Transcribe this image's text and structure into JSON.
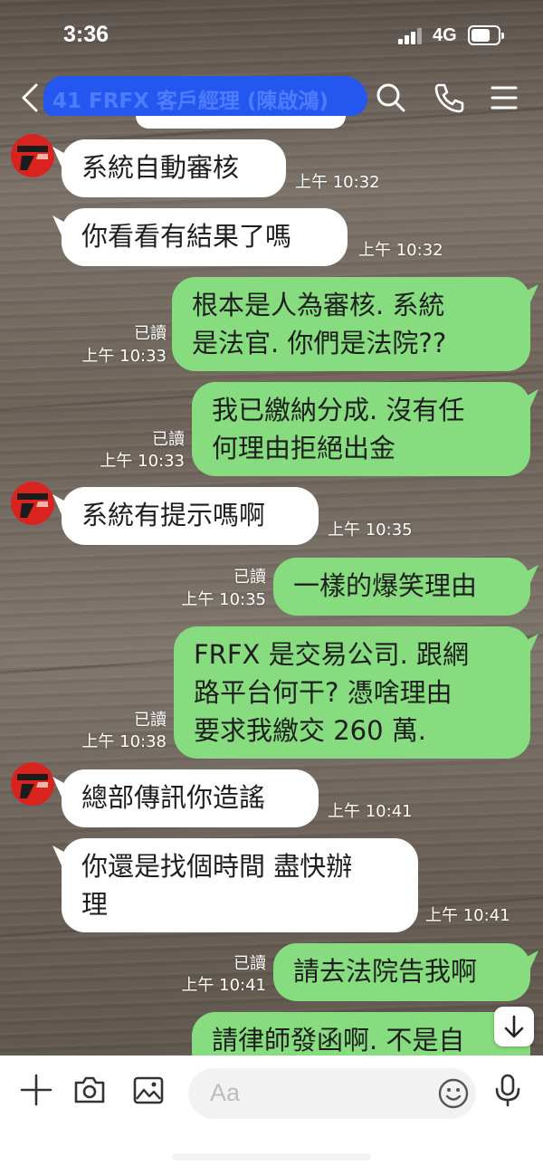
{
  "status_bar": {
    "time": "3:36",
    "network": "4G"
  },
  "header": {
    "title": "41   FRFX 客戶經理 (陳啟鴻)"
  },
  "messages": [
    {
      "text": "系統自動審核",
      "time": "上午 10:32"
    },
    {
      "text": "你看看有結果了嗎",
      "time": "上午 10:32"
    },
    {
      "line1": "根本是人為審核. 系統",
      "line2": "是法官. 你們是法院??",
      "read": "已讀",
      "time": "上午 10:33"
    },
    {
      "line1": "我已繳納分成. 沒有任",
      "line2": "何理由拒絕出金",
      "read": "已讀",
      "time": "上午 10:33"
    },
    {
      "text": "系統有提示嗎啊",
      "time": "上午 10:35"
    },
    {
      "text": "一樣的爆笑理由",
      "read": "已讀",
      "time": "上午 10:35"
    },
    {
      "line1": "FRFX  是交易公司. 跟網",
      "line2": "路平台何干? 憑啥理由",
      "line3": "要求我繳交 260 萬.",
      "read": "已讀",
      "time": "上午 10:38"
    },
    {
      "text": "總部傳訊你造謠",
      "time": "上午 10:41"
    },
    {
      "line1": "你還是找個時間 盡快辦",
      "line2": "理",
      "time": "上午 10:41"
    },
    {
      "text": "請去法院告我啊",
      "read": "已讀",
      "time": "上午 10:41"
    },
    {
      "text": "請律師發函啊. 不是自"
    }
  ],
  "input_bar": {
    "placeholder": "Aa"
  },
  "colors": {
    "incoming_bubble": "#ffffff",
    "outgoing_bubble": "#86dc7e",
    "title_redaction": "#2457f0"
  },
  "icons": [
    "back-icon",
    "search-icon",
    "phone-icon",
    "menu-icon",
    "scroll-down-icon",
    "plus-icon",
    "camera-icon",
    "image-icon",
    "emoji-icon",
    "microphone-icon"
  ]
}
